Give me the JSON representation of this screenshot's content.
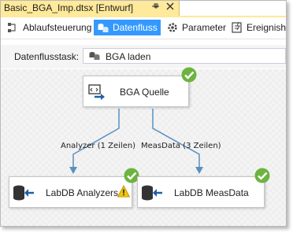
{
  "document_tab": {
    "title": "Basic_BGA_Imp.dtsx [Entwurf]",
    "pin_icon": "pin-icon",
    "close_icon": "close-icon"
  },
  "designer_tabs": [
    {
      "label": "Ablaufsteuerung",
      "icon": "control-flow-icon",
      "active": false
    },
    {
      "label": "Datenfluss",
      "icon": "data-flow-icon",
      "active": true
    },
    {
      "label": "Parameter",
      "icon": "parameters-icon",
      "active": false
    },
    {
      "label": "Ereignish",
      "icon": "event-handlers-icon",
      "active": false
    }
  ],
  "task_selector": {
    "label": "Datenflusstask:",
    "value": "BGA laden",
    "icon": "data-flow-task-icon"
  },
  "components": {
    "source": {
      "label": "BGA Quelle",
      "icon": "source-icon",
      "status": "success"
    },
    "dest_analyzers": {
      "label": "LabDB Analyzers",
      "icon": "destination-icon",
      "status": "success",
      "warning": true
    },
    "dest_measdata": {
      "label": "LabDB MeasData",
      "icon": "destination-icon",
      "status": "success"
    }
  },
  "paths": {
    "left": {
      "label": "Analyzer (1 Zeilen)"
    },
    "right": {
      "label": "MeasData (3 Zeilen)"
    }
  },
  "colors": {
    "tab_accent": "#ffe99a",
    "active_tab": "#3399ff",
    "path_line": "#5b8fbf",
    "success": "#6db33f"
  }
}
